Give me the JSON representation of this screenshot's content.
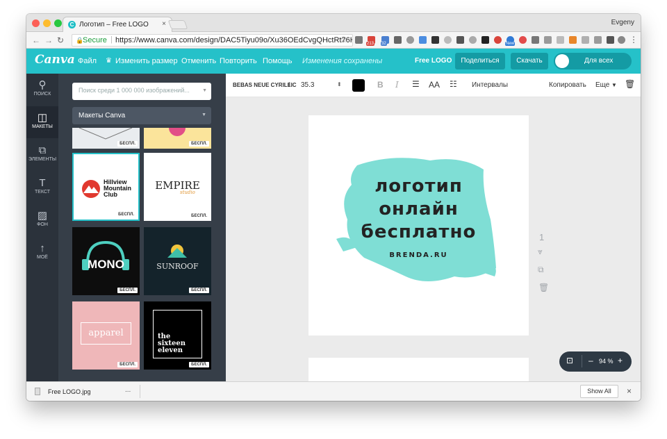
{
  "browser": {
    "tab_title": "Логотип – Free LOGO",
    "tab_favicon": "C",
    "tab_close": "×",
    "user": "Evgeny",
    "secure_label": "Secure",
    "url": "https://www.canva.com/design/DAC5Tiyu09o/Xu36OEdCvgQHctRt76HkJ...",
    "badge_counts": [
      "213",
      "32"
    ],
    "new_badge": "New"
  },
  "header": {
    "logo": "Canva",
    "menu": [
      "Файл",
      "Изменить размер",
      "Отменить",
      "Повторить",
      "Помощь"
    ],
    "status": "Изменения сохранены",
    "free_logo": "Free LOGO",
    "share": "Поделиться",
    "download": "Скачать",
    "toggle_label": "Для всех",
    "colors": {
      "accent": "#25c1c9",
      "button": "#149ba4",
      "rail": "#2b323b",
      "panel": "#363e48"
    }
  },
  "rail": [
    {
      "label": "ПОИСК",
      "icon": "search-icon"
    },
    {
      "label": "МАКЕТЫ",
      "icon": "layouts-icon"
    },
    {
      "label": "ЭЛЕМЕНТЫ",
      "icon": "elements-icon"
    },
    {
      "label": "ТЕКСТ",
      "icon": "text-icon"
    },
    {
      "label": "ФОН",
      "icon": "background-icon"
    },
    {
      "label": "МОЁ",
      "icon": "upload-icon"
    }
  ],
  "panel": {
    "search_placeholder": "Поиск среди 1 000 000 изображений...",
    "category": "Макеты Canva",
    "badge": "БЕСПЛ.",
    "templates": [
      {
        "title": "Hillview Mountain Club"
      },
      {
        "title": "EMPIRE",
        "subtitle": "studio"
      },
      {
        "title": "MONO"
      },
      {
        "title": "SUNROOF"
      },
      {
        "title": "apparel"
      },
      {
        "title": "the sixteen eleven"
      }
    ]
  },
  "toolbar": {
    "font": "BEBAS NEUE CYRILLIC",
    "size": "35.3",
    "bold": "B",
    "italic": "I",
    "case": "AA",
    "spacing": "Интервалы",
    "copy": "Копировать",
    "more": "Еще",
    "text_color": "#000000"
  },
  "canvas": {
    "lines": [
      "логотип",
      "онлайн",
      "бесплатно"
    ],
    "subtitle": "BRENDA.RU",
    "page_number": "1",
    "brush_color": "#7fded5",
    "zoom": "94 %",
    "zoom_minus": "–",
    "zoom_plus": "+"
  },
  "downloads": {
    "file": "Free LOGO.jpg",
    "more": "...",
    "show_all": "Show All",
    "close": "×"
  }
}
